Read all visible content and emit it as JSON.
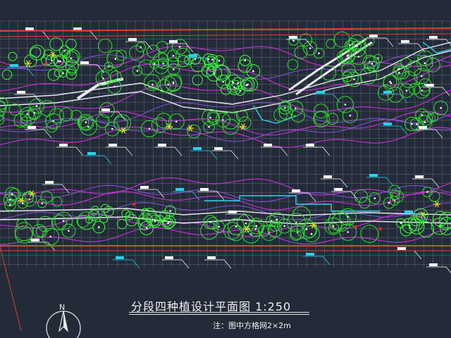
{
  "drawing": {
    "title": "分段四种植设计平面图 1:250",
    "note": "注：图中方格网2×2m",
    "north_label": "N"
  },
  "colors": {
    "background": "#232b38",
    "grid": "#6c7485",
    "boundary_red": "#d9432c",
    "path_white": "#e8e8f0",
    "contour_magenta": "#c22fd0",
    "contour_purple": "#8a4fe0",
    "tree_green": "#2fe02f",
    "shrub_bright": "#38ff38",
    "water_cyan": "#2fd3e8",
    "label_cyan": "#2bd2ee",
    "label_white": "#ffffff",
    "flower_yellow": "#e8e020",
    "accent_red": "#ff2020"
  }
}
